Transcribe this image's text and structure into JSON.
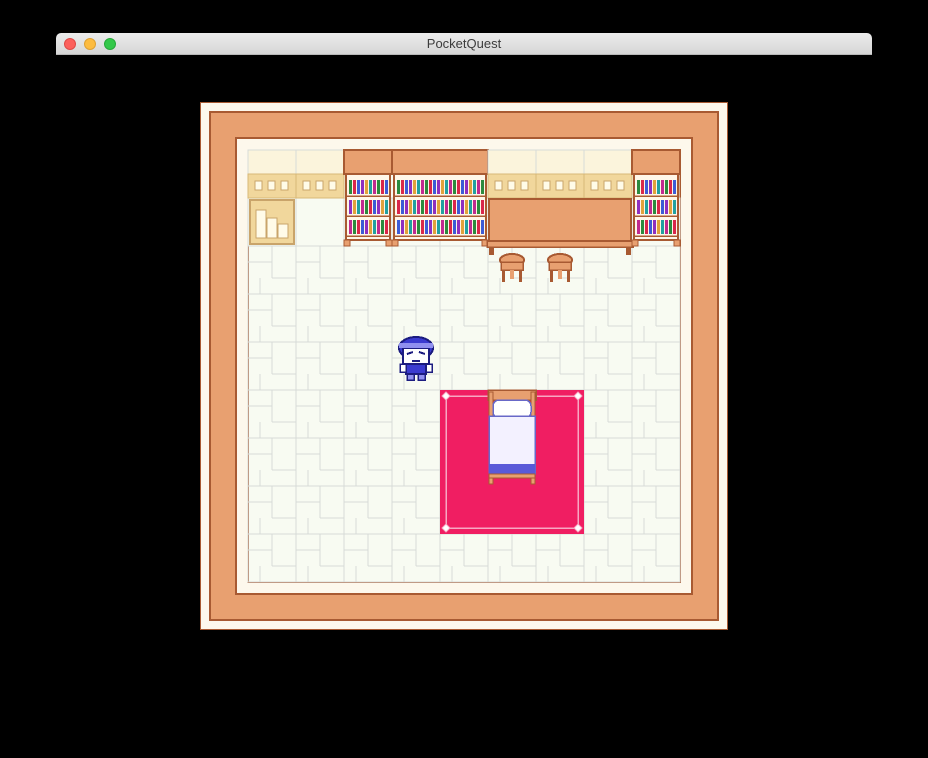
{
  "window": {
    "title": "PocketQuest"
  },
  "scene": {
    "name": "bedroom",
    "palette": {
      "frame_outer": "#fdf8ec",
      "frame_wall": "#e8a070",
      "frame_line": "#a85a32",
      "floor": "#f8fbf2",
      "floor_grid": "#d7dbd8",
      "shelf_top": "#fbf4dc",
      "shelf_band": "#f1d79c",
      "wood": "#e8a070",
      "wood_dark": "#a85a32",
      "rug": "#f01e62",
      "rug_trim": "#f7a7c2",
      "player": "#3b3bd0",
      "player_light": "#9090f0",
      "bed_sheet": "#f3f1ff"
    },
    "objects": [
      "cupboard-left",
      "cupboard-left-2",
      "bookshelf-left",
      "bookshelf-wide",
      "counter",
      "bookshelf-right",
      "stool-left",
      "stool-right",
      "player-character",
      "rug",
      "bed"
    ]
  }
}
